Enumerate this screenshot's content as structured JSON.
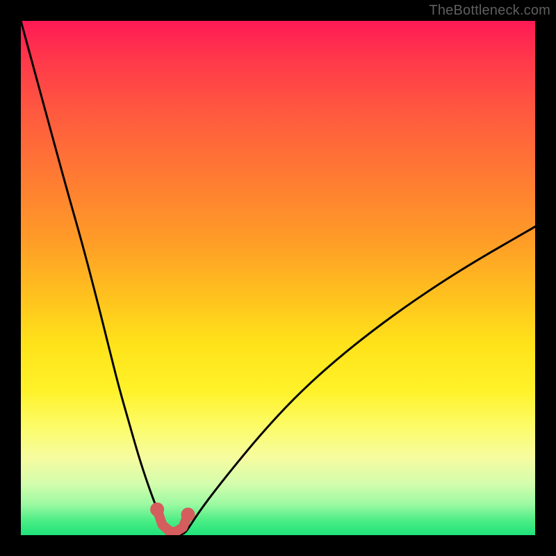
{
  "watermark": "TheBottleneck.com",
  "colors": {
    "curve": "#000000",
    "marker": "#d45d5d",
    "gradient_top": "#ff1a55",
    "gradient_mid": "#ffe31a",
    "gradient_bottom": "#1ee37a",
    "frame": "#000000"
  },
  "chart_data": {
    "type": "line",
    "title": "",
    "xlabel": "",
    "ylabel": "",
    "x_range_normalized": [
      0,
      100
    ],
    "y_range_percent": [
      0,
      100
    ],
    "series": [
      {
        "name": "bottleneck-curve",
        "x": [
          0,
          3,
          6,
          9,
          12,
          15,
          17,
          19,
          21,
          23,
          25,
          26.5,
          28,
          29,
          30,
          31,
          32,
          33,
          35,
          38,
          42,
          47,
          53,
          60,
          68,
          77,
          87,
          100
        ],
        "y": [
          100,
          89,
          78,
          67,
          56.5,
          45,
          37,
          29,
          22,
          15,
          9,
          5,
          2,
          0.5,
          0,
          0,
          0.5,
          2,
          5,
          9,
          14,
          20,
          26.5,
          33,
          39.5,
          46,
          52.5,
          60
        ]
      }
    ],
    "markers": [
      {
        "name": "left-dot",
        "x": 26.5,
        "y": 5
      },
      {
        "name": "bottom-dot",
        "x": 29.5,
        "y": 0.3
      },
      {
        "name": "right-dot",
        "x": 32.5,
        "y": 4
      }
    ],
    "marker_connector": [
      {
        "x": 26.5,
        "y": 5
      },
      {
        "x": 27.5,
        "y": 2
      },
      {
        "x": 29.5,
        "y": 0.3
      },
      {
        "x": 31.5,
        "y": 1.5
      },
      {
        "x": 32.5,
        "y": 4
      }
    ],
    "legend": [],
    "grid": false
  }
}
